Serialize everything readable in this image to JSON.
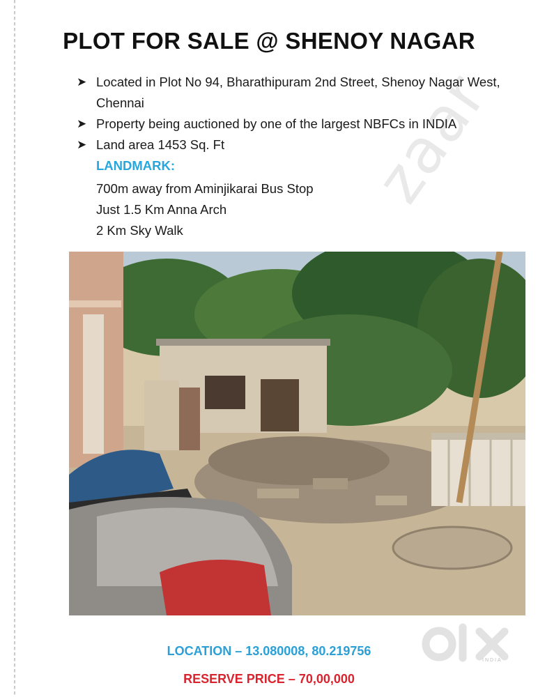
{
  "title": "PLOT FOR SALE @ SHENOY NAGAR",
  "bullets": [
    "Located in Plot No 94, Bharathipuram 2nd Street, Shenoy Nagar West, Chennai",
    "Property being auctioned by one of the largest NBFCs in INDIA",
    "Land area 1453 Sq. Ft"
  ],
  "bullet_icon": "arrow-right-icon",
  "landmark": {
    "heading": "LANDMARK:",
    "items": [
      "700m away from Aminjikarai Bus Stop",
      "Just 1.5 Km Anna Arch",
      "2 Km Sky Walk"
    ]
  },
  "watermark_text": "zaar",
  "location": "LOCATION – 13.080008, 80.219756",
  "reserve_price": "RESERVE PRICE – 70,00,000",
  "logo": {
    "text": "OLX",
    "sub": "INDIA"
  },
  "colors": {
    "landmark": "#27a7de",
    "location": "#2c9fd6",
    "price": "#d9232e"
  }
}
